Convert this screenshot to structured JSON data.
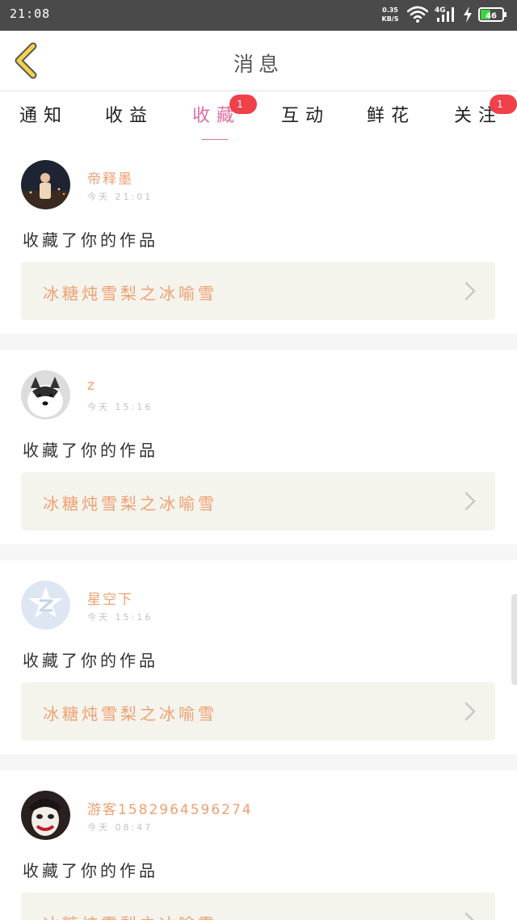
{
  "status_bar": {
    "time": "21:08",
    "net_speed_value": "0.35",
    "net_speed_unit": "KB/S",
    "signal_label": "4G",
    "battery_level": "46",
    "icons": [
      "wifi-icon",
      "signal-icon",
      "charge-icon",
      "battery-icon"
    ]
  },
  "header": {
    "title": "消息",
    "back_icon": "chevron-left-icon"
  },
  "tabs": [
    {
      "label": "通知",
      "badge": ""
    },
    {
      "label": "收益",
      "badge": ""
    },
    {
      "label": "收藏",
      "badge": "1",
      "active": true
    },
    {
      "label": "互动",
      "badge": ""
    },
    {
      "label": "鲜花",
      "badge": ""
    },
    {
      "label": "关注",
      "badge": "1"
    }
  ],
  "messages": [
    {
      "username": "帝释墨",
      "time": "今天 21:01",
      "action": "收藏了你的作品",
      "work_title": "冰糖炖雪梨之冰喻雪"
    },
    {
      "username": "z",
      "time": "今天 15:16",
      "action": "收藏了你的作品",
      "work_title": "冰糖炖雪梨之冰喻雪"
    },
    {
      "username": "星空下",
      "time": "今天 15:16",
      "action": "收藏了你的作品",
      "work_title": "冰糖炖雪梨之冰喻雪"
    },
    {
      "username": "游客1582964596274",
      "time": "今天 08:47",
      "action": "收藏了你的作品",
      "work_title": "冰糖炖雪梨之冰喻雪"
    }
  ],
  "colors": {
    "accent": "#e06fa0",
    "username": "#f0a070",
    "badge": "#f0404a",
    "back_icon": "#f2d24a",
    "link_background": "#f4f4ed"
  }
}
